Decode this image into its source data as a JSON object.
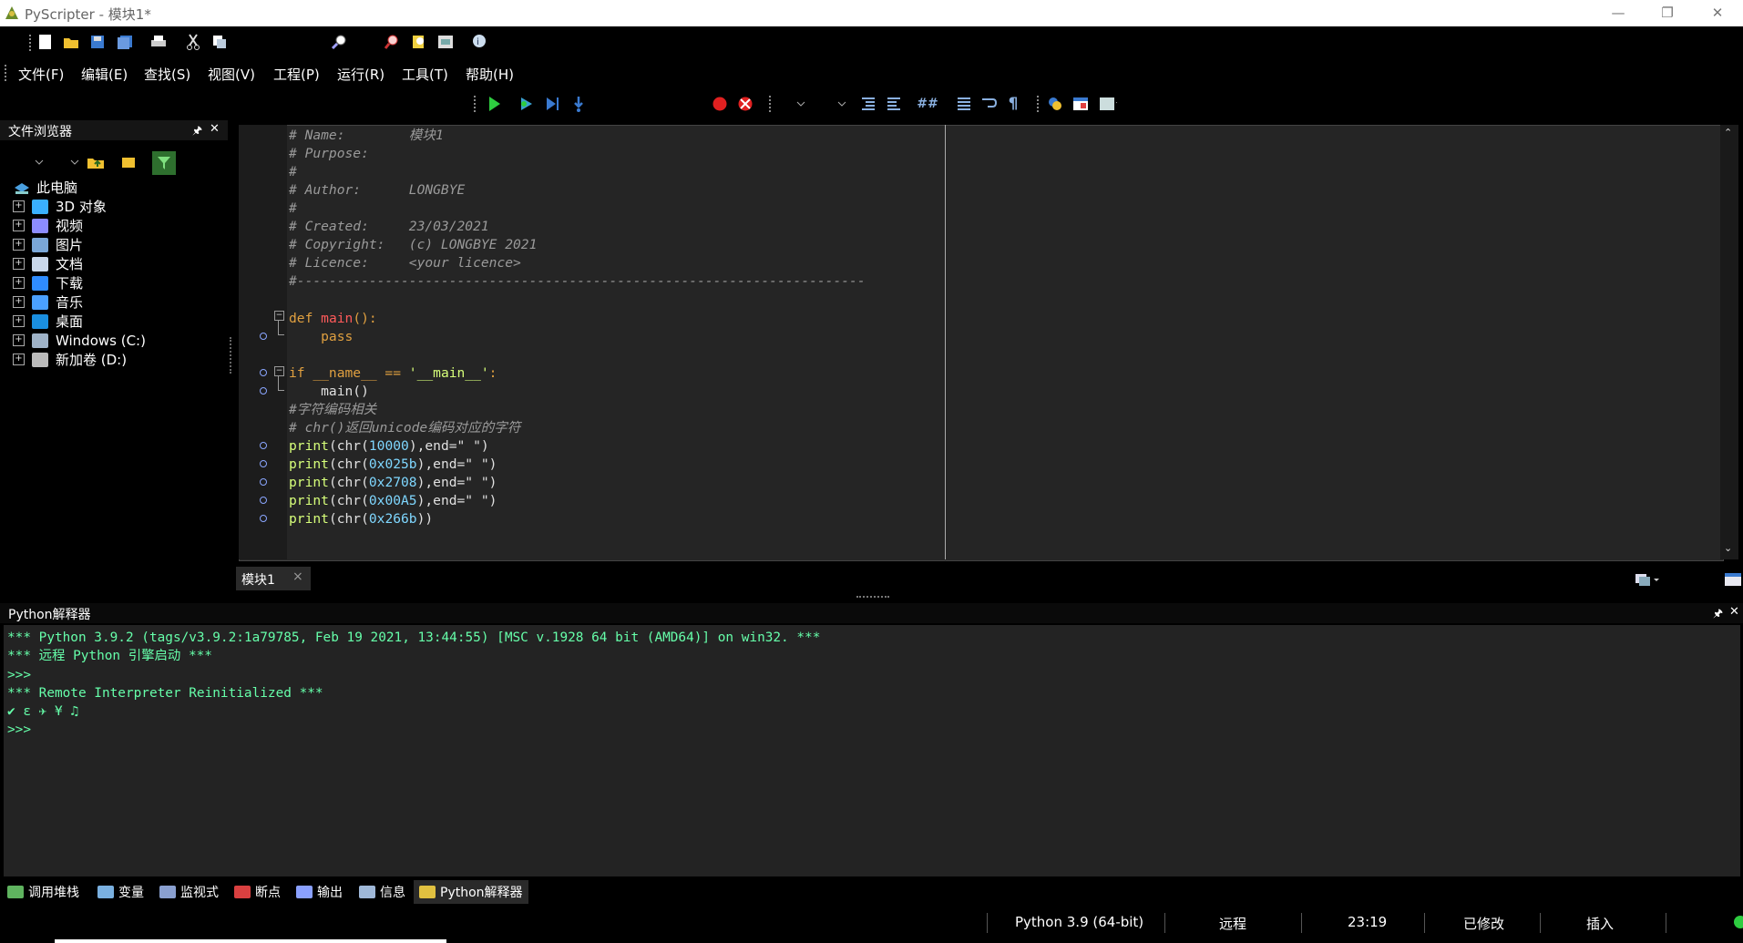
{
  "window": {
    "title": "PyScripter - 模块1*",
    "minimize": "—",
    "restore": "❐",
    "close": "✕"
  },
  "menu": [
    "文件(F)",
    "编辑(E)",
    "查找(S)",
    "视图(V)",
    "工程(P)",
    "运行(R)",
    "工具(T)",
    "帮助(H)"
  ],
  "file_browser": {
    "title": "文件浏览器",
    "pin": "🖈",
    "close": "✕",
    "root": "此电脑",
    "items": [
      {
        "label": "3D 对象",
        "icon": "3d-objects-icon",
        "color": "#3ab0ff"
      },
      {
        "label": "视频",
        "icon": "video-icon",
        "color": "#8c8cff"
      },
      {
        "label": "图片",
        "icon": "pictures-icon",
        "color": "#7aa7d8"
      },
      {
        "label": "文档",
        "icon": "documents-icon",
        "color": "#c9d7ea"
      },
      {
        "label": "下载",
        "icon": "download-icon",
        "color": "#2f8cff"
      },
      {
        "label": "音乐",
        "icon": "music-icon",
        "color": "#4aa0ff"
      },
      {
        "label": "桌面",
        "icon": "desktop-icon",
        "color": "#1a8fe0"
      },
      {
        "label": "Windows (C:)",
        "icon": "drive-icon",
        "color": "#9fb3c8"
      },
      {
        "label": "新加卷 (D:)",
        "icon": "drive-icon",
        "color": "#bbbbbb"
      }
    ]
  },
  "editor": {
    "tab_label": "模块1",
    "tab_close": "×",
    "lines": [
      {
        "parts": [
          {
            "t": "# Name:        模块1",
            "c": "cmt"
          }
        ]
      },
      {
        "parts": [
          {
            "t": "# Purpose:",
            "c": "cmt"
          }
        ]
      },
      {
        "parts": [
          {
            "t": "#",
            "c": "cmt"
          }
        ]
      },
      {
        "parts": [
          {
            "t": "# Author:      LONGBYE",
            "c": "cmt"
          }
        ]
      },
      {
        "parts": [
          {
            "t": "#",
            "c": "cmt"
          }
        ]
      },
      {
        "parts": [
          {
            "t": "# Created:     23/03/2021",
            "c": "cmt"
          }
        ]
      },
      {
        "parts": [
          {
            "t": "# Copyright:   (c) LONGBYE 2021",
            "c": "cmt"
          }
        ]
      },
      {
        "parts": [
          {
            "t": "# Licence:     <your licence>",
            "c": "cmt"
          }
        ]
      },
      {
        "parts": [
          {
            "t": "#-----------------------------------------------------------------------",
            "c": "cmt"
          }
        ]
      },
      {
        "parts": [
          {
            "t": "",
            "c": "str"
          }
        ]
      },
      {
        "parts": [
          {
            "t": "def ",
            "c": "kw"
          },
          {
            "t": "main",
            "c": "fn"
          },
          {
            "t": "():",
            "c": "kw"
          }
        ]
      },
      {
        "parts": [
          {
            "t": "    pass",
            "c": "kw"
          }
        ]
      },
      {
        "parts": [
          {
            "t": "",
            "c": "str"
          }
        ]
      },
      {
        "parts": [
          {
            "t": "if ",
            "c": "kw"
          },
          {
            "t": "__name__ == ",
            "c": "kw"
          },
          {
            "t": "'__main__'",
            "c": "nm"
          },
          {
            "t": ":",
            "c": "kw"
          }
        ]
      },
      {
        "parts": [
          {
            "t": "    main()",
            "c": "str"
          }
        ]
      },
      {
        "parts": [
          {
            "t": "#字符编码相关",
            "c": "cmt"
          }
        ]
      },
      {
        "parts": [
          {
            "t": "# chr()返回unicode编码对应的字符",
            "c": "cmt"
          }
        ]
      },
      {
        "parts": [
          {
            "t": "print",
            "c": "nm"
          },
          {
            "t": "(chr(",
            "c": "str"
          },
          {
            "t": "10000",
            "c": "num"
          },
          {
            "t": "),end=\" \")",
            "c": "str"
          }
        ]
      },
      {
        "parts": [
          {
            "t": "print",
            "c": "nm"
          },
          {
            "t": "(chr(",
            "c": "str"
          },
          {
            "t": "0x025b",
            "c": "num"
          },
          {
            "t": "),end=\" \")",
            "c": "str"
          }
        ]
      },
      {
        "parts": [
          {
            "t": "print",
            "c": "nm"
          },
          {
            "t": "(chr(",
            "c": "str"
          },
          {
            "t": "0x2708",
            "c": "num"
          },
          {
            "t": "),end=\" \")",
            "c": "str"
          }
        ]
      },
      {
        "parts": [
          {
            "t": "print",
            "c": "nm"
          },
          {
            "t": "(chr(",
            "c": "str"
          },
          {
            "t": "0x00A5",
            "c": "num"
          },
          {
            "t": "),end=\" \")",
            "c": "str"
          }
        ]
      },
      {
        "parts": [
          {
            "t": "print",
            "c": "nm"
          },
          {
            "t": "(chr(",
            "c": "str"
          },
          {
            "t": "0x266b",
            "c": "num"
          },
          {
            "t": "))",
            "c": "str"
          }
        ]
      }
    ]
  },
  "interpreter": {
    "title": "Python解释器",
    "pin": "🖈",
    "close": "✕",
    "lines": [
      "*** Python 3.9.2 (tags/v3.9.2:1a79785, Feb 19 2021, 13:44:55) [MSC v.1928 64 bit (AMD64)] on win32. ***",
      "*** 远程 Python 引擎启动 ***",
      ">>>",
      "*** Remote Interpreter Reinitialized ***",
      "✔ ɛ ✈ ¥ ♫",
      ">>>"
    ]
  },
  "bottom_tabs": [
    {
      "label": "调用堆栈",
      "icon": "call-stack-icon",
      "color": "#5fb35f"
    },
    {
      "label": "变量",
      "icon": "variables-icon",
      "color": "#7ab0e0"
    },
    {
      "label": "监视式",
      "icon": "watches-icon",
      "color": "#8aa0d0"
    },
    {
      "label": "断点",
      "icon": "breakpoints-icon",
      "color": "#d94040"
    },
    {
      "label": "输出",
      "icon": "output-icon",
      "color": "#8aa0ff"
    },
    {
      "label": "信息",
      "icon": "messages-icon",
      "color": "#9fb8d8"
    },
    {
      "label": "Python解释器",
      "icon": "python-icon",
      "color": "#e0c040"
    }
  ],
  "status": {
    "python": "Python 3.9 (64-bit)",
    "engine": "远程",
    "position": "23:19",
    "modified": "已修改",
    "mode": "插入"
  },
  "colors": {
    "accent": "#2ecc40",
    "code_bg": "#252525",
    "interp_text": "#66ffaa"
  }
}
